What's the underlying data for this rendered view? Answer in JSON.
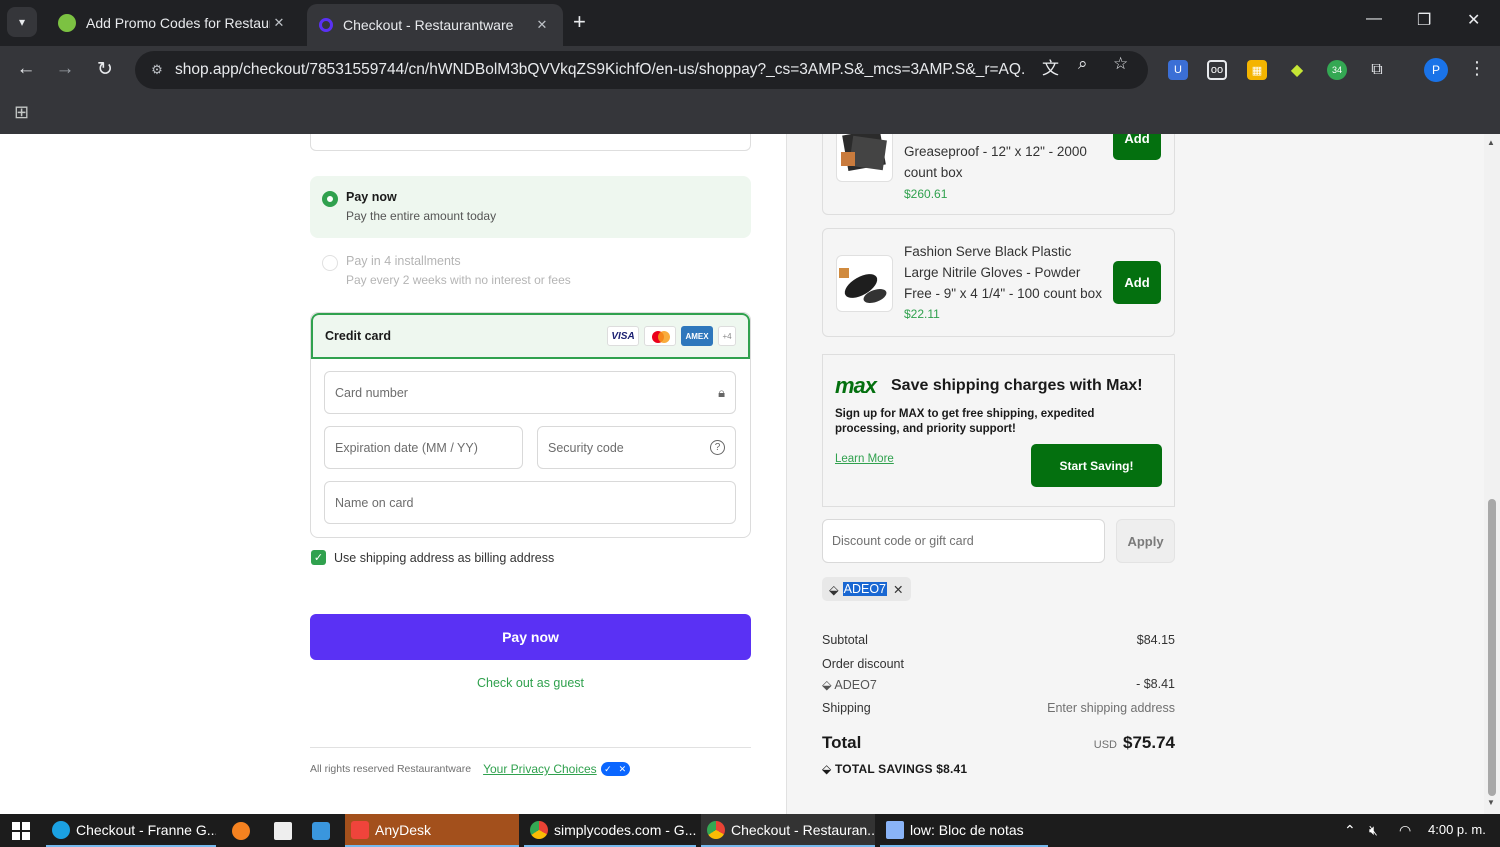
{
  "browser": {
    "tabs": [
      {
        "title": "Add Promo Codes for Restaurantware"
      },
      {
        "title": "Checkout - Restaurantware"
      }
    ],
    "url": "shop.app/checkout/78531559744/cn/hWNDBolM3bQVVkqZS9KichfO/en-us/shoppay?_cs=3AMP.S&_mcs=3AMP.S&_r=AQ...",
    "profile_initial": "P",
    "extension_badge": "34"
  },
  "payment": {
    "pay_now": {
      "title": "Pay now",
      "subtitle": "Pay the entire amount today"
    },
    "installments": {
      "title": "Pay in 4 installments",
      "subtitle": "Pay every 2 weeks with no interest or fees"
    },
    "credit_card": {
      "label": "Credit card",
      "logos": [
        "VISA",
        "Mastercard",
        "AMEX",
        "+4"
      ],
      "card_number_placeholder": "Card number",
      "expiry_placeholder": "Expiration date (MM / YY)",
      "security_placeholder": "Security code",
      "name_placeholder": "Name on card"
    },
    "billing_checkbox": "Use shipping address as billing address",
    "pay_button": "Pay now",
    "guest_link": "Check out as guest"
  },
  "footer": {
    "rights": "All rights reserved Restaurantware",
    "privacy": "Your Privacy Choices"
  },
  "products": [
    {
      "name": "Greaseproof - 12\" x 12\" - 2000 count box",
      "price": "$260.61",
      "button": "Add"
    },
    {
      "name": "Fashion Serve Black Plastic Large Nitrile Gloves - Powder Free - 9\" x 4 1/4\" - 100 count box",
      "price": "$22.11",
      "button": "Add"
    }
  ],
  "max_promo": {
    "logo": "max",
    "title": "Save shipping charges with Max!",
    "description": "Sign up for MAX to get free shipping, expedited processing, and priority support!",
    "learn_more": "Learn More",
    "cta": "Start Saving!"
  },
  "discount": {
    "placeholder": "Discount code or gift card",
    "apply": "Apply",
    "applied_code": "ADEO7"
  },
  "summary": {
    "subtotal_label": "Subtotal",
    "subtotal": "$84.15",
    "order_discount_label": "Order discount",
    "discount_code": "ADEO7",
    "discount_amount": "- $8.41",
    "shipping_label": "Shipping",
    "shipping_value": "Enter shipping address",
    "total_label": "Total",
    "currency": "USD",
    "total": "$75.74",
    "savings": "TOTAL SAVINGS $8.41"
  },
  "taskbar": {
    "items": [
      {
        "label": "Checkout - Franne G..."
      },
      {
        "label": "AnyDesk"
      },
      {
        "label": "simplycodes.com - G..."
      },
      {
        "label": "Checkout - Restauran..."
      },
      {
        "label": "low: Bloc de notas"
      }
    ],
    "clock": "4:00 p. m."
  },
  "colors": {
    "accent_green": "#30a14e",
    "button_green": "#04700f",
    "shop_purple": "#5a31f4"
  }
}
